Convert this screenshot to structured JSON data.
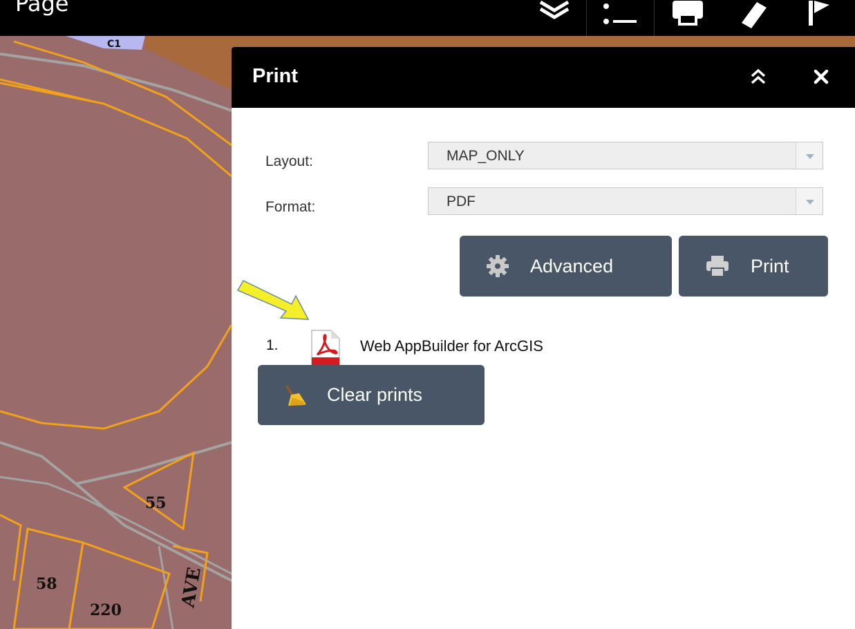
{
  "topbar": {
    "page_title_fragment": "Page",
    "icons": [
      "layers-icon",
      "legend-icon",
      "print-icon",
      "measure-icon",
      "bookmark-icon"
    ]
  },
  "map": {
    "parcel_labels": [
      "C1",
      "55",
      "58",
      "220"
    ],
    "street_label": "AVE",
    "colors": {
      "parcel_fill": "#9a6b6b",
      "boundary": "#f2a21a",
      "road": "#a3a3a3",
      "commercial": "#b7b8f0",
      "brown": "#a86a3c"
    }
  },
  "panel": {
    "title": "Print",
    "collapse_icon": "double-chevron-up-icon",
    "close_icon": "close-icon",
    "layout_label": "Layout:",
    "layout_value": "MAP_ONLY",
    "format_label": "Format:",
    "format_value": "PDF",
    "advanced_label": "Advanced",
    "print_label": "Print",
    "results": [
      {
        "number": "1.",
        "title": "Web AppBuilder for ArcGIS",
        "icon": "pdf-file-icon"
      }
    ],
    "clear_label": "Clear prints"
  },
  "colors": {
    "header_bg": "#000000",
    "button_bg": "#485667",
    "select_bg": "#eeeeee",
    "annotation_arrow": "#f5ef2a"
  }
}
